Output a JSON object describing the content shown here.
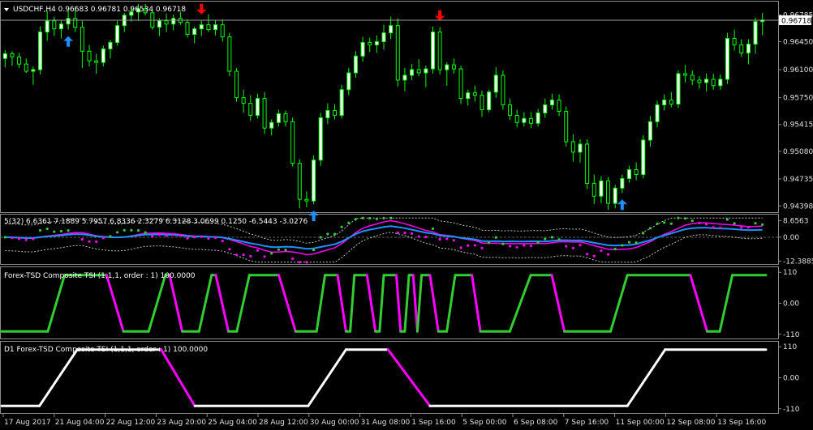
{
  "chart_data": {
    "type": "candlestick",
    "main": {
      "header": "USDCHF,H4  0.96683 0.96781 0.96534 0.96718",
      "symbol": "USDCHF",
      "timeframe": "H4",
      "ohlc_header": [
        "0.96683",
        "0.96781",
        "0.96534",
        "0.96718"
      ],
      "price_ticks": [
        "0.96785",
        "0.96450",
        "0.96100",
        "0.95750",
        "0.95415",
        "0.95080",
        "0.94735",
        "0.94398"
      ],
      "current_price": "0.96718",
      "ylim": [
        0.9433,
        0.9694
      ],
      "candles": [
        [
          0.9624,
          0.9634,
          0.9613,
          0.963
        ],
        [
          0.963,
          0.9633,
          0.9615,
          0.9626
        ],
        [
          0.9626,
          0.9631,
          0.9612,
          0.9617
        ],
        [
          0.9617,
          0.9624,
          0.9606,
          0.9608
        ],
        [
          0.9608,
          0.9614,
          0.9591,
          0.961
        ],
        [
          0.961,
          0.9664,
          0.9604,
          0.9657
        ],
        [
          0.9657,
          0.9683,
          0.9646,
          0.9671
        ],
        [
          0.9671,
          0.9676,
          0.9652,
          0.9661
        ],
        [
          0.9661,
          0.9672,
          0.9649,
          0.9667
        ],
        [
          0.9667,
          0.9683,
          0.966,
          0.9674
        ],
        [
          0.9674,
          0.9689,
          0.9657,
          0.9663
        ],
        [
          0.9663,
          0.9671,
          0.9612,
          0.9633
        ],
        [
          0.9633,
          0.9641,
          0.9614,
          0.9621
        ],
        [
          0.9621,
          0.963,
          0.9605,
          0.9619
        ],
        [
          0.9619,
          0.964,
          0.9614,
          0.9636
        ],
        [
          0.9636,
          0.9647,
          0.9624,
          0.9644
        ],
        [
          0.9644,
          0.9671,
          0.964,
          0.9665
        ],
        [
          0.9665,
          0.9681,
          0.9657,
          0.9678
        ],
        [
          0.9678,
          0.9689,
          0.967,
          0.9682
        ],
        [
          0.9682,
          0.9692,
          0.9671,
          0.9686
        ],
        [
          0.9686,
          0.9692,
          0.9678,
          0.9681
        ],
        [
          0.9681,
          0.9684,
          0.966,
          0.9663
        ],
        [
          0.9663,
          0.9674,
          0.9652,
          0.9671
        ],
        [
          0.9671,
          0.968,
          0.9657,
          0.9667
        ],
        [
          0.9667,
          0.9679,
          0.9659,
          0.9674
        ],
        [
          0.9674,
          0.9682,
          0.9666,
          0.9669
        ],
        [
          0.9669,
          0.9673,
          0.965,
          0.9654
        ],
        [
          0.9654,
          0.9664,
          0.9643,
          0.9661
        ],
        [
          0.9661,
          0.9671,
          0.9652,
          0.9666
        ],
        [
          0.9666,
          0.9679,
          0.9657,
          0.966
        ],
        [
          0.966,
          0.9672,
          0.9653,
          0.9666
        ],
        [
          0.9666,
          0.9673,
          0.9645,
          0.9651
        ],
        [
          0.9651,
          0.9656,
          0.9602,
          0.9608
        ],
        [
          0.9608,
          0.9612,
          0.957,
          0.9575
        ],
        [
          0.9575,
          0.9585,
          0.9556,
          0.9568
        ],
        [
          0.9568,
          0.9578,
          0.9546,
          0.9553
        ],
        [
          0.9553,
          0.958,
          0.9549,
          0.9574
        ],
        [
          0.9574,
          0.9582,
          0.953,
          0.9537
        ],
        [
          0.9537,
          0.9548,
          0.9528,
          0.9544
        ],
        [
          0.9544,
          0.956,
          0.9539,
          0.9555
        ],
        [
          0.9555,
          0.9559,
          0.9539,
          0.9545
        ],
        [
          0.9545,
          0.955,
          0.9489,
          0.9493
        ],
        [
          0.9493,
          0.9498,
          0.9437,
          0.9448
        ],
        [
          0.9448,
          0.9458,
          0.9438,
          0.9446
        ],
        [
          0.9446,
          0.9503,
          0.9442,
          0.9497
        ],
        [
          0.9497,
          0.9556,
          0.949,
          0.955
        ],
        [
          0.955,
          0.9568,
          0.9542,
          0.9559
        ],
        [
          0.9559,
          0.9567,
          0.9548,
          0.9553
        ],
        [
          0.9553,
          0.9591,
          0.9549,
          0.9585
        ],
        [
          0.9585,
          0.9612,
          0.9578,
          0.9606
        ],
        [
          0.9606,
          0.9633,
          0.96,
          0.9627
        ],
        [
          0.9627,
          0.9651,
          0.962,
          0.9644
        ],
        [
          0.9644,
          0.965,
          0.9632,
          0.9641
        ],
        [
          0.9641,
          0.9653,
          0.9631,
          0.9645
        ],
        [
          0.9645,
          0.9666,
          0.9635,
          0.9656
        ],
        [
          0.9656,
          0.9676,
          0.9648,
          0.9665
        ],
        [
          0.9665,
          0.9674,
          0.9589,
          0.9597
        ],
        [
          0.9597,
          0.9612,
          0.9583,
          0.9603
        ],
        [
          0.9603,
          0.9617,
          0.9597,
          0.961
        ],
        [
          0.961,
          0.9623,
          0.9602,
          0.9606
        ],
        [
          0.9606,
          0.9615,
          0.9588,
          0.9611
        ],
        [
          0.9611,
          0.9664,
          0.9605,
          0.9657
        ],
        [
          0.9657,
          0.9663,
          0.9604,
          0.961
        ],
        [
          0.961,
          0.9619,
          0.959,
          0.9616
        ],
        [
          0.9616,
          0.9624,
          0.9605,
          0.9611
        ],
        [
          0.9611,
          0.9615,
          0.9567,
          0.9574
        ],
        [
          0.9574,
          0.9585,
          0.9565,
          0.9581
        ],
        [
          0.9581,
          0.959,
          0.957,
          0.9578
        ],
        [
          0.9578,
          0.9584,
          0.9551,
          0.956
        ],
        [
          0.956,
          0.9585,
          0.9557,
          0.9582
        ],
        [
          0.9582,
          0.9613,
          0.9575,
          0.9603
        ],
        [
          0.9603,
          0.9609,
          0.956,
          0.9566
        ],
        [
          0.9566,
          0.9574,
          0.9547,
          0.9553
        ],
        [
          0.9553,
          0.956,
          0.9538,
          0.9544
        ],
        [
          0.9544,
          0.9557,
          0.9539,
          0.9549
        ],
        [
          0.9549,
          0.9557,
          0.9537,
          0.9543
        ],
        [
          0.9543,
          0.9561,
          0.9539,
          0.9556
        ],
        [
          0.9556,
          0.9574,
          0.955,
          0.9566
        ],
        [
          0.9566,
          0.958,
          0.956,
          0.9572
        ],
        [
          0.9572,
          0.9579,
          0.9552,
          0.9558
        ],
        [
          0.9558,
          0.9564,
          0.9514,
          0.952
        ],
        [
          0.952,
          0.9529,
          0.9495,
          0.9507
        ],
        [
          0.9507,
          0.9523,
          0.9494,
          0.9517
        ],
        [
          0.9517,
          0.9523,
          0.9461,
          0.9468
        ],
        [
          0.9468,
          0.9479,
          0.9442,
          0.9452
        ],
        [
          0.9452,
          0.9477,
          0.9443,
          0.9471
        ],
        [
          0.9471,
          0.9476,
          0.9435,
          0.9443
        ],
        [
          0.9443,
          0.9466,
          0.9437,
          0.9462
        ],
        [
          0.9462,
          0.9479,
          0.9456,
          0.9474
        ],
        [
          0.9474,
          0.949,
          0.9469,
          0.9485
        ],
        [
          0.9485,
          0.9494,
          0.9472,
          0.9479
        ],
        [
          0.9479,
          0.9528,
          0.9474,
          0.9522
        ],
        [
          0.9522,
          0.9552,
          0.9514,
          0.9545
        ],
        [
          0.9545,
          0.9571,
          0.9538,
          0.9566
        ],
        [
          0.9566,
          0.9579,
          0.9559,
          0.9572
        ],
        [
          0.9572,
          0.9582,
          0.9563,
          0.9567
        ],
        [
          0.9567,
          0.9609,
          0.9562,
          0.9605
        ],
        [
          0.9605,
          0.9616,
          0.9594,
          0.9603
        ],
        [
          0.9603,
          0.9609,
          0.9591,
          0.9597
        ],
        [
          0.9597,
          0.9602,
          0.9586,
          0.9594
        ],
        [
          0.9594,
          0.9605,
          0.9583,
          0.9598
        ],
        [
          0.9598,
          0.9605,
          0.9585,
          0.959
        ],
        [
          0.959,
          0.9604,
          0.9585,
          0.9598
        ],
        [
          0.9598,
          0.9656,
          0.9592,
          0.9649
        ],
        [
          0.9649,
          0.966,
          0.9634,
          0.9641
        ],
        [
          0.9641,
          0.9648,
          0.9626,
          0.9631
        ],
        [
          0.9631,
          0.9648,
          0.9617,
          0.9642
        ],
        [
          0.9642,
          0.9675,
          0.963,
          0.967
        ],
        [
          0.967,
          0.9681,
          0.9653,
          0.9672
        ]
      ],
      "up_arrows": [
        9,
        44,
        88
      ],
      "down_arrows": [
        28,
        62
      ]
    },
    "bands": {
      "header": "5(32) 6.6361 7.1889 5.7957 6.8336 2.3279 6.3128 3.0699 0.1250 -6.5443 -3.0276",
      "ticks": [
        "8.6563",
        "0.00",
        "-12.3885"
      ],
      "ylim": [
        -13.5,
        10.5
      ],
      "zero": 0
    },
    "tsi": {
      "header": "Forex-TSD Composite TSI (1,1,1, order : 1) 100.0000",
      "ticks": [
        "110",
        "0.00",
        "-110"
      ],
      "ylim": [
        -125,
        125
      ],
      "high": 100,
      "low": -100,
      "path": [
        [
          0,
          -1
        ],
        [
          11,
          -1
        ],
        [
          15,
          1
        ],
        [
          25,
          1
        ],
        [
          29,
          -1
        ],
        [
          35,
          -1
        ],
        [
          39,
          1
        ],
        [
          40,
          1
        ],
        [
          43,
          -1
        ],
        [
          47,
          -1
        ],
        [
          50,
          1
        ],
        [
          51,
          1
        ],
        [
          54,
          -1
        ],
        [
          56,
          -1
        ],
        [
          59,
          1
        ],
        [
          66,
          1
        ],
        [
          70,
          -1
        ],
        [
          75,
          -1
        ],
        [
          77,
          1
        ],
        [
          80,
          1
        ],
        [
          82,
          -1
        ],
        [
          83,
          -1
        ],
        [
          84,
          1
        ],
        [
          87,
          1
        ],
        [
          89,
          -1
        ],
        [
          90,
          -1
        ],
        [
          91,
          1
        ],
        [
          94,
          1
        ],
        [
          95,
          -1
        ],
        [
          96,
          -1
        ],
        [
          97,
          1
        ],
        [
          98,
          1
        ],
        [
          99,
          -1
        ],
        [
          100,
          1
        ],
        [
          102,
          1
        ],
        [
          104,
          -1
        ],
        [
          106,
          -1
        ],
        [
          108,
          1
        ],
        [
          112,
          1
        ],
        [
          114,
          -1
        ],
        [
          121,
          -1
        ],
        [
          126,
          1
        ],
        [
          131,
          1
        ],
        [
          134,
          -1
        ],
        [
          145,
          -1
        ],
        [
          149,
          1
        ],
        [
          164,
          1
        ],
        [
          168,
          -1
        ],
        [
          171,
          -1
        ],
        [
          174,
          1
        ],
        [
          182,
          1
        ]
      ]
    },
    "d1tsi": {
      "header": "D1 Forex-TSD Composite TSI (1,1,1, order : 1) 100.0000",
      "ticks": [
        "110",
        "0.00",
        "-110"
      ],
      "ylim": [
        -125,
        125
      ],
      "high": 100,
      "low": -100,
      "path": [
        [
          0,
          -1
        ],
        [
          9,
          -1
        ],
        [
          18,
          1
        ],
        [
          38,
          1
        ],
        [
          46,
          -1
        ],
        [
          73,
          -1
        ],
        [
          82,
          1
        ],
        [
          92,
          1
        ],
        [
          102,
          -1
        ],
        [
          149,
          -1
        ],
        [
          158,
          1
        ],
        [
          182,
          1
        ]
      ]
    },
    "time_labels": [
      "17 Aug 2017",
      "21 Aug 04:00",
      "22 Aug 12:00",
      "23 Aug 20:00",
      "25 Aug 04:00",
      "28 Aug 12:00",
      "30 Aug 00:00",
      "31 Aug 08:00",
      "1 Sep 16:00",
      "5 Sep 00:00",
      "6 Sep 08:00",
      "7 Sep 16:00",
      "11 Sep 00:00",
      "12 Sep 08:00",
      "13 Sep 16:00"
    ],
    "colors": {
      "background": "#000000",
      "bull": "#ffffff",
      "bear": "#000000",
      "wick": "#00ff00",
      "up_arrow": "#1e90ff",
      "down_arrow": "#ff0000",
      "magenta": "#ff00ff",
      "green": "#32cd32",
      "blue": "#1e90ff",
      "white_line": "#ffffff"
    }
  }
}
